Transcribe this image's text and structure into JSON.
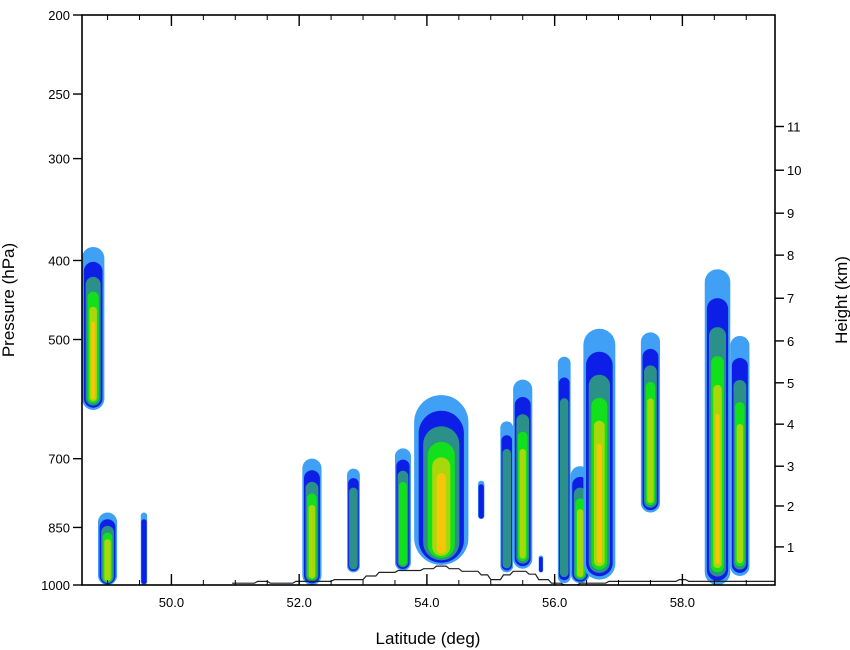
{
  "chart_data": {
    "type": "contour",
    "title": "",
    "xlabel": "Latitude (deg)",
    "ylabel_left": "Pressure (hPa)",
    "ylabel_right": "Height (km)",
    "x_range": [
      48.6,
      59.45
    ],
    "x_ticks": [
      {
        "value": 50,
        "label": "50.0"
      },
      {
        "value": 52,
        "label": "52.0"
      },
      {
        "value": 54,
        "label": "54.0"
      },
      {
        "value": 56,
        "label": "56.0"
      },
      {
        "value": 58,
        "label": "58.0"
      }
    ],
    "x_minor_step": 0.5,
    "y_left_scale": "log",
    "y_left_range": [
      1000,
      200
    ],
    "y_left_ticks": [
      {
        "value": 200,
        "label": "200"
      },
      {
        "value": 250,
        "label": "250"
      },
      {
        "value": 300,
        "label": "300"
      },
      {
        "value": 400,
        "label": "400"
      },
      {
        "value": 500,
        "label": "500"
      },
      {
        "value": 700,
        "label": "700"
      },
      {
        "value": 850,
        "label": "850"
      },
      {
        "value": 1000,
        "label": "1000"
      }
    ],
    "y_right_ticks": [
      {
        "pressure": 898,
        "label": "1"
      },
      {
        "pressure": 800,
        "label": "2"
      },
      {
        "pressure": 715,
        "label": "3"
      },
      {
        "pressure": 635,
        "label": "4"
      },
      {
        "pressure": 565,
        "label": "5"
      },
      {
        "pressure": 502,
        "label": "6"
      },
      {
        "pressure": 445,
        "label": "7"
      },
      {
        "pressure": 394,
        "label": "8"
      },
      {
        "pressure": 350,
        "label": "9"
      },
      {
        "pressure": 310,
        "label": "10"
      },
      {
        "pressure": 274,
        "label": "11"
      }
    ],
    "contour_colors": [
      "#3fa0f5",
      "#0d1fe6",
      "#2b8f8a",
      "#13e01c",
      "#a8d80a",
      "#f5c60a"
    ],
    "terrain_color": "#222222",
    "cells": [
      {
        "lat_min": 48.6,
        "lat_max": 48.95,
        "p_top": 385,
        "p_bottom": 610
      },
      {
        "lat_min": 48.85,
        "lat_max": 49.15,
        "p_top": 815,
        "p_bottom": 1000
      },
      {
        "lat_min": 49.52,
        "lat_max": 49.62,
        "p_top": 815,
        "p_bottom": 1000
      },
      {
        "lat_min": 52.05,
        "lat_max": 52.35,
        "p_top": 700,
        "p_bottom": 1000
      },
      {
        "lat_min": 52.75,
        "lat_max": 52.95,
        "p_top": 720,
        "p_bottom": 965
      },
      {
        "lat_min": 53.5,
        "lat_max": 53.75,
        "p_top": 680,
        "p_bottom": 960
      },
      {
        "lat_min": 53.8,
        "lat_max": 54.65,
        "p_top": 585,
        "p_bottom": 945
      },
      {
        "lat_min": 55.15,
        "lat_max": 55.35,
        "p_top": 630,
        "p_bottom": 965
      },
      {
        "lat_min": 55.35,
        "lat_max": 55.65,
        "p_top": 560,
        "p_bottom": 955
      },
      {
        "lat_min": 56.05,
        "lat_max": 56.25,
        "p_top": 525,
        "p_bottom": 995
      },
      {
        "lat_min": 56.25,
        "lat_max": 56.55,
        "p_top": 715,
        "p_bottom": 995
      },
      {
        "lat_min": 56.45,
        "lat_max": 56.95,
        "p_top": 485,
        "p_bottom": 985
      },
      {
        "lat_min": 57.35,
        "lat_max": 57.65,
        "p_top": 490,
        "p_bottom": 815
      },
      {
        "lat_min": 58.35,
        "lat_max": 58.75,
        "p_top": 410,
        "p_bottom": 1000
      },
      {
        "lat_min": 58.75,
        "lat_max": 59.05,
        "p_top": 495,
        "p_bottom": 975
      },
      {
        "lat_min": 54.8,
        "lat_max": 54.9,
        "p_top": 745,
        "p_bottom": 830
      },
      {
        "lat_min": 55.75,
        "lat_max": 55.82,
        "p_top": 920,
        "p_bottom": 965
      }
    ],
    "terrain": [
      [
        50.95,
        995
      ],
      [
        51.3,
        995
      ],
      [
        51.35,
        990
      ],
      [
        51.5,
        990
      ],
      [
        51.55,
        995
      ],
      [
        51.9,
        995
      ],
      [
        51.95,
        990
      ],
      [
        52.5,
        990
      ],
      [
        52.55,
        985
      ],
      [
        53.0,
        985
      ],
      [
        53.05,
        975
      ],
      [
        53.2,
        975
      ],
      [
        53.25,
        965
      ],
      [
        53.5,
        965
      ],
      [
        53.55,
        960
      ],
      [
        53.9,
        960
      ],
      [
        53.95,
        955
      ],
      [
        54.1,
        955
      ],
      [
        54.15,
        948
      ],
      [
        54.3,
        948
      ],
      [
        54.35,
        955
      ],
      [
        54.5,
        955
      ],
      [
        54.55,
        962
      ],
      [
        54.8,
        962
      ],
      [
        54.85,
        972
      ],
      [
        54.95,
        972
      ],
      [
        55.0,
        985
      ],
      [
        55.15,
        985
      ],
      [
        55.2,
        972
      ],
      [
        55.3,
        972
      ],
      [
        55.35,
        962
      ],
      [
        55.55,
        962
      ],
      [
        55.6,
        970
      ],
      [
        55.7,
        970
      ],
      [
        55.75,
        985
      ],
      [
        55.9,
        985
      ],
      [
        55.95,
        995
      ],
      [
        56.1,
        995
      ],
      [
        56.15,
        1000
      ],
      [
        56.35,
        1000
      ],
      [
        56.4,
        995
      ],
      [
        56.8,
        995
      ],
      [
        56.85,
        990
      ],
      [
        57.9,
        990
      ],
      [
        57.95,
        985
      ],
      [
        58.05,
        985
      ],
      [
        58.1,
        990
      ],
      [
        59.45,
        990
      ]
    ]
  }
}
